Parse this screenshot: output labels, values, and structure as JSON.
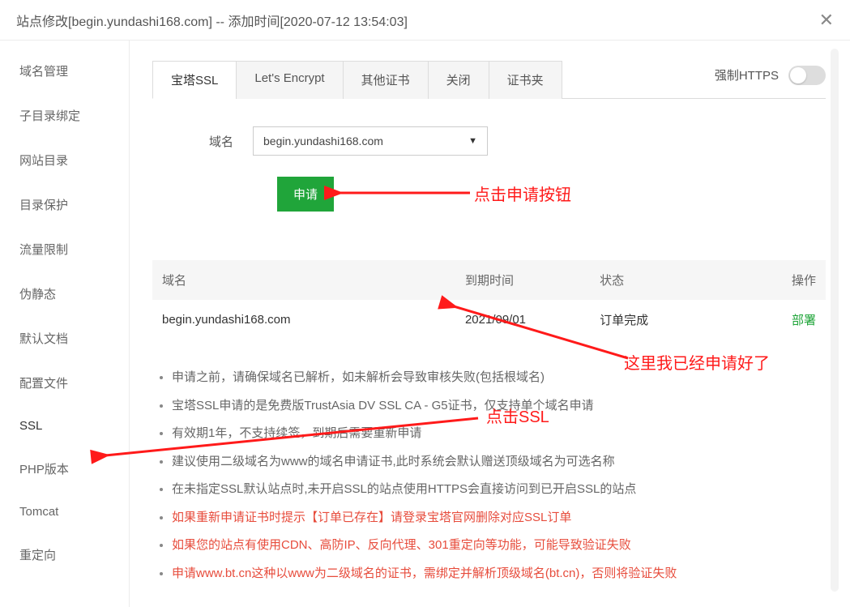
{
  "window": {
    "title": "站点修改[begin.yundashi168.com] -- 添加时间[2020-07-12 13:54:03]"
  },
  "sidebar": {
    "items": [
      {
        "label": "域名管理"
      },
      {
        "label": "子目录绑定"
      },
      {
        "label": "网站目录"
      },
      {
        "label": "目录保护"
      },
      {
        "label": "流量限制"
      },
      {
        "label": "伪静态"
      },
      {
        "label": "默认文档"
      },
      {
        "label": "配置文件"
      },
      {
        "label": "SSL"
      },
      {
        "label": "PHP版本"
      },
      {
        "label": "Tomcat"
      },
      {
        "label": "重定向"
      }
    ]
  },
  "tabs": [
    {
      "label": "宝塔SSL"
    },
    {
      "label": "Let's Encrypt"
    },
    {
      "label": "其他证书"
    },
    {
      "label": "关闭"
    },
    {
      "label": "证书夹"
    }
  ],
  "force_https": {
    "label": "强制HTTPS",
    "enabled": false
  },
  "form": {
    "domain_label": "域名",
    "domain_selected": "begin.yundashi168.com",
    "apply_label": "申请"
  },
  "table": {
    "headers": {
      "domain": "域名",
      "expire": "到期时间",
      "status": "状态",
      "action": "操作"
    },
    "rows": [
      {
        "domain": "begin.yundashi168.com",
        "expire": "2021/09/01",
        "status": "订单完成",
        "action": "部署"
      }
    ]
  },
  "notes": [
    {
      "text": "申请之前，请确保域名已解析，如未解析会导致审核失败(包括根域名)",
      "color": "normal"
    },
    {
      "text": "宝塔SSL申请的是免费版TrustAsia DV SSL CA - G5证书，仅支持单个域名申请",
      "color": "normal"
    },
    {
      "text": "有效期1年，不支持续签，到期后需要重新申请",
      "color": "normal"
    },
    {
      "text": "建议使用二级域名为www的域名申请证书,此时系统会默认赠送顶级域名为可选名称",
      "color": "normal"
    },
    {
      "text": "在未指定SSL默认站点时,未开启SSL的站点使用HTTPS会直接访问到已开启SSL的站点",
      "color": "normal"
    },
    {
      "text": "如果重新申请证书时提示【订单已存在】请登录宝塔官网删除对应SSL订单",
      "color": "red"
    },
    {
      "text": "如果您的站点有使用CDN、高防IP、反向代理、301重定向等功能，可能导致验证失败",
      "color": "red"
    },
    {
      "text": "申请www.bt.cn这种以www为二级域名的证书，需绑定并解析顶级域名(bt.cn)，否则将验证失败",
      "color": "red"
    }
  ],
  "annotations": {
    "apply_hint": "点击申请按钮",
    "row_hint": "这里我已经申请好了",
    "ssl_hint": "点击SSL"
  }
}
